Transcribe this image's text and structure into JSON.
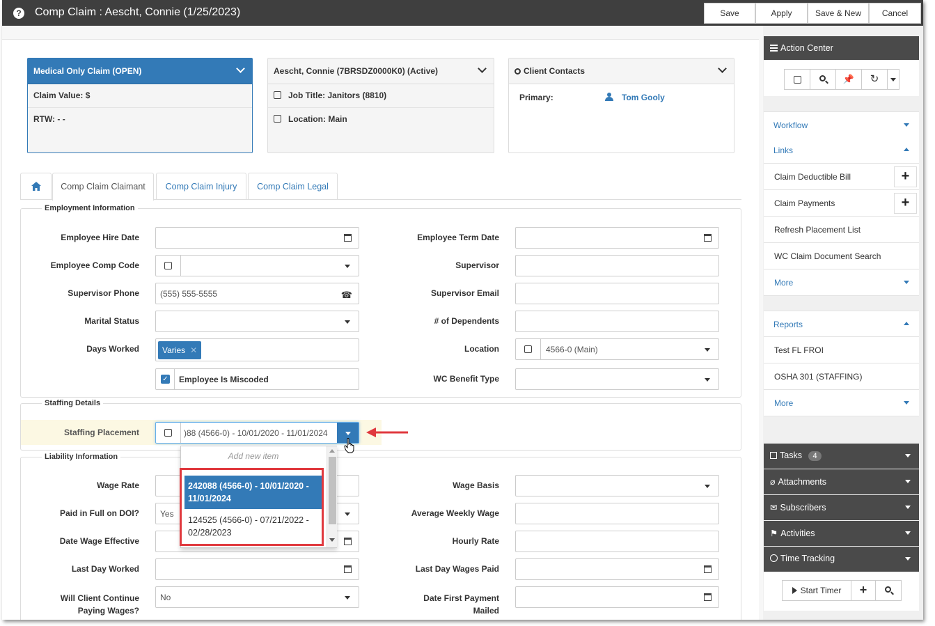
{
  "window": {
    "title": "Comp Claim : Aescht, Connie (1/25/2023)",
    "buttons": {
      "save": "Save",
      "apply": "Apply",
      "save_new": "Save & New",
      "cancel": "Cancel"
    }
  },
  "summary": {
    "claim": {
      "header": "Medical Only Claim (OPEN)",
      "claim_value": "Claim Value: $",
      "rtw": "RTW:  -  -"
    },
    "employee": {
      "header": "Aescht, Connie (7BRSDZ0000K0) (Active)",
      "job_title": "Job Title: Janitors (8810)",
      "location": "Location: Main"
    },
    "contacts": {
      "header": "Client Contacts",
      "primary_label": "Primary:",
      "primary_name": "Tom Gooly"
    }
  },
  "tabs": {
    "claimant": "Comp Claim Claimant",
    "injury": "Comp Claim Injury",
    "legal": "Comp Claim Legal"
  },
  "employment": {
    "legend": "Employment Information",
    "hire_date_label": "Employee Hire Date",
    "term_date_label": "Employee Term Date",
    "comp_code_label": "Employee Comp Code",
    "supervisor_label": "Supervisor",
    "supervisor_phone_label": "Supervisor Phone",
    "supervisor_phone_value": "(555) 555-5555",
    "supervisor_email_label": "Supervisor Email",
    "marital_label": "Marital Status",
    "dependents_label": "# of Dependents",
    "days_worked_label": "Days Worked",
    "days_worked_tag": "Varies",
    "location_label": "Location",
    "location_value": "4566-0 (Main)",
    "miscoded_label": "Employee Is Miscoded",
    "benefit_label": "WC Benefit Type"
  },
  "staffing": {
    "legend": "Staffing Details",
    "placement_label": "Staffing Placement",
    "placement_value": ")88 (4566-0)  - 10/01/2020 - 11/01/2024",
    "dropdown_add": "Add new item",
    "options": [
      "242088 (4566-0) - 10/01/2020 - 11/01/2024",
      "124525 (4566-0) - 07/21/2022 - 02/28/2023"
    ]
  },
  "liability": {
    "legend": "Liability Information",
    "wage_rate_label": "Wage Rate",
    "wage_basis_label": "Wage Basis",
    "paid_full_label": "Paid in Full on DOI?",
    "paid_full_value": "Yes",
    "avg_wage_label": "Average Weekly Wage",
    "date_wage_label": "Date Wage Effective",
    "hourly_label": "Hourly Rate",
    "last_day_label": "Last Day Worked",
    "last_wages_label": "Last Day Wages Paid",
    "continue_label_1": "Will Client Continue",
    "continue_label_2": "Paying Wages?",
    "continue_value": "No",
    "first_payment_label_1": "Date First Payment",
    "first_payment_label_2": "Mailed"
  },
  "sidebar": {
    "action_center": "Action Center",
    "workflow": "Workflow",
    "links": "Links",
    "link_items": [
      "Claim Deductible Bill",
      "Claim Payments",
      "Refresh Placement List",
      "WC Claim Document Search"
    ],
    "more": "More",
    "reports": "Reports",
    "report_items": [
      "Test FL FROI",
      "OSHA 301 (STAFFING)"
    ],
    "tasks": "Tasks",
    "tasks_count": "4",
    "attachments": "Attachments",
    "subscribers": "Subscribers",
    "activities": "Activities",
    "time_tracking": "Time Tracking",
    "start_timer": "Start Timer"
  },
  "colors": {
    "primary_blue": "#337ab7",
    "titlebar": "#3f3f3f",
    "highlight_red": "#e0393e"
  }
}
